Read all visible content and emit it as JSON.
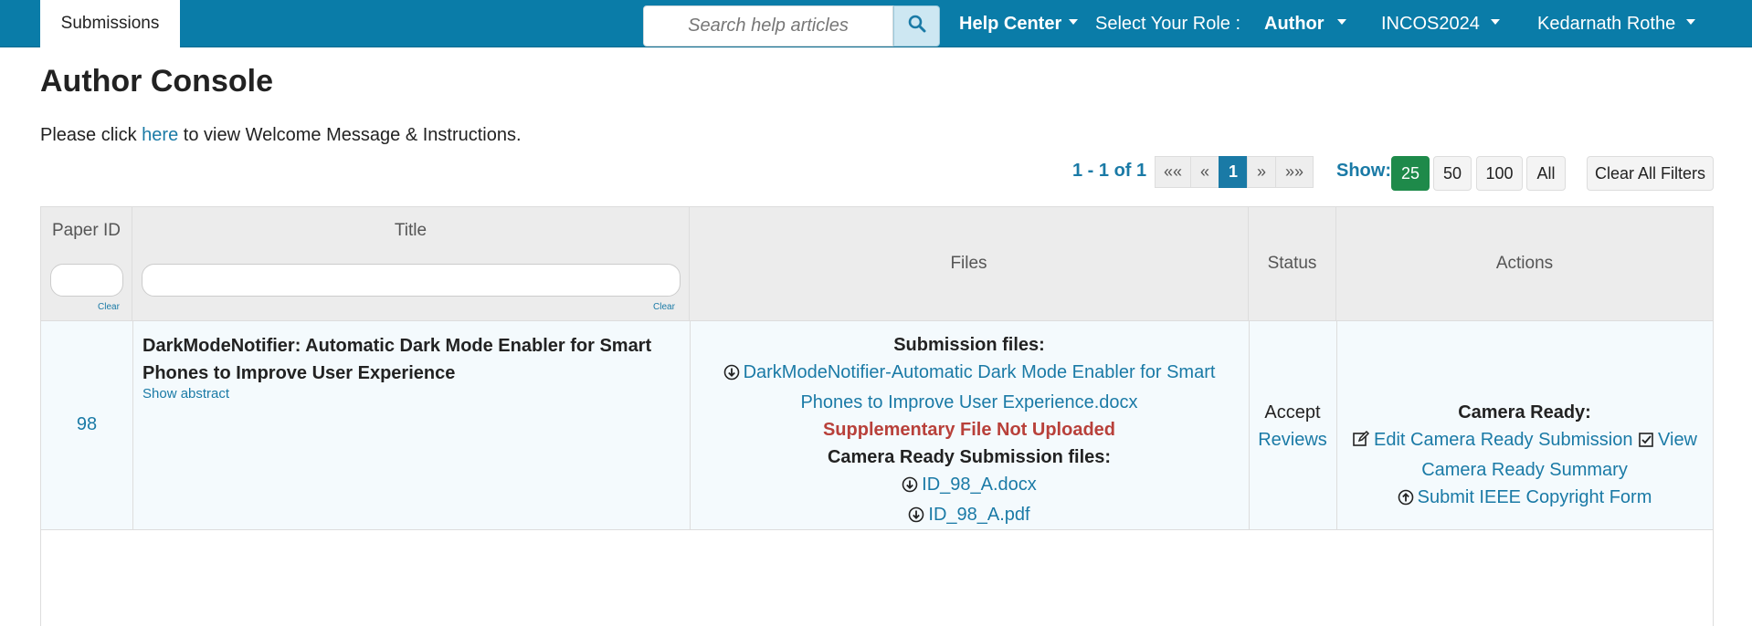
{
  "nav": {
    "submissions_tab": "Submissions",
    "search_placeholder": "Search help articles",
    "help_center": "Help Center",
    "role_label": "Select Your Role :",
    "role_value": "Author",
    "conference": "INCOS2024",
    "user": "Kedarnath Rothe"
  },
  "header": {
    "title": "Author Console",
    "welcome_prefix": "Please click",
    "welcome_link": "here",
    "welcome_suffix": "to view Welcome Message & Instructions."
  },
  "pagination": {
    "range": "1 - 1 of 1",
    "first": "««",
    "prev": "«",
    "current": "1",
    "next": "»",
    "last": "»»",
    "show_label": "Show:",
    "sizes": [
      "25",
      "50",
      "100",
      "All"
    ],
    "selected_size": "25",
    "clear_filters": "Clear All Filters"
  },
  "table": {
    "columns": {
      "paper_id": "Paper ID",
      "title": "Title",
      "files": "Files",
      "status": "Status",
      "actions": "Actions"
    },
    "clear": "Clear",
    "rows": [
      {
        "paper_id": "98",
        "title_line1": "DarkModeNotifier: Automatic Dark Mode Enabler for Smart",
        "title_line2": "Phones to Improve User Experience",
        "show_abstract": "Show abstract",
        "files": {
          "submission_heading": "Submission files:",
          "submission_file_line1": "DarkModeNotifier-Automatic Dark Mode Enabler for Smart",
          "submission_file_line2": "Phones to Improve User Experience.docx",
          "supplementary_status": "Supplementary File Not Uploaded",
          "camera_ready_heading": "Camera Ready Submission files:",
          "camera_file_1": "ID_98_A.docx",
          "camera_file_2": "ID_98_A.pdf"
        },
        "status": "Accept",
        "status_link": "Reviews",
        "actions": {
          "heading": "Camera Ready:",
          "edit": "Edit Camera Ready Submission",
          "view_line1": "View",
          "view_line2": "Camera Ready Summary",
          "copyright": "Submit IEEE Copyright Form"
        }
      }
    ]
  },
  "colors": {
    "navbar": "#0a7ca8",
    "link": "#1a7aa6",
    "active_green": "#1e8a4a",
    "warning_red": "#b8403a"
  }
}
